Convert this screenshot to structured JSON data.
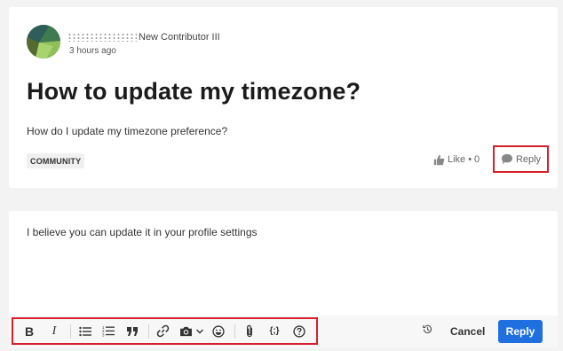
{
  "post": {
    "author_rank": "New Contributor III",
    "timestamp": "3 hours ago",
    "title": "How to update my timezone?",
    "body": "How do I update my timezone preference?",
    "tag": "COMMUNITY",
    "like_label": "Like",
    "like_separator": "•",
    "like_count": "0",
    "reply_label": "Reply"
  },
  "editor": {
    "text": "I believe you can update it in your profile settings",
    "toolbar": {
      "bold": "B",
      "italic": "I",
      "code_sample": "{;}",
      "icons": [
        "bold-icon",
        "italic-icon",
        "bulleted-list-icon",
        "numbered-list-icon",
        "quote-icon",
        "link-icon",
        "camera-icon",
        "chevron-down-icon",
        "emoji-icon",
        "attachment-icon",
        "code-icon",
        "help-icon",
        "history-icon"
      ]
    },
    "cancel_label": "Cancel",
    "submit_label": "Reply"
  },
  "colors": {
    "accent": "#1f6fe0",
    "highlight": "#d6202c",
    "background": "#f3f3f3"
  }
}
